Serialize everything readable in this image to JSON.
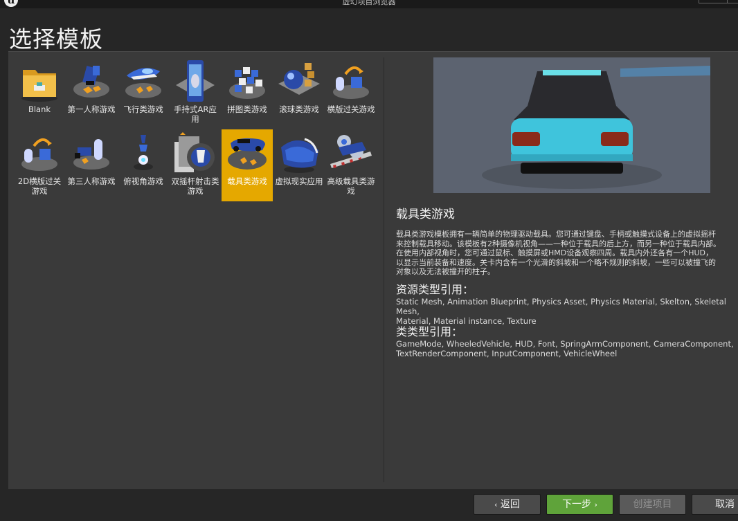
{
  "window": {
    "title": "虚幻项目浏览器",
    "logo": "u"
  },
  "page_title": "选择模板",
  "templates": [
    {
      "label": "Blank",
      "icon": "folder-icon"
    },
    {
      "label": "第一人称游戏",
      "icon": "first-person-icon"
    },
    {
      "label": "飞行类游戏",
      "icon": "flying-icon"
    },
    {
      "label": "手持式AR应用",
      "icon": "handheld-ar-icon"
    },
    {
      "label": "拼图类游戏",
      "icon": "puzzle-icon"
    },
    {
      "label": "滚球类游戏",
      "icon": "rolling-icon"
    },
    {
      "label": "横版过关游戏",
      "icon": "side-scroller-icon"
    },
    {
      "label": "2D横版过关游戏",
      "icon": "2d-side-scroller-icon"
    },
    {
      "label": "第三人称游戏",
      "icon": "third-person-icon"
    },
    {
      "label": "俯视角游戏",
      "icon": "top-down-icon"
    },
    {
      "label": "双摇杆射击类游戏",
      "icon": "twin-stick-icon"
    },
    {
      "label": "载具类游戏",
      "icon": "vehicle-icon",
      "selected": true
    },
    {
      "label": "虚拟现实应用",
      "icon": "vr-icon"
    },
    {
      "label": "高级载具类游戏",
      "icon": "advanced-vehicle-icon"
    }
  ],
  "detail": {
    "title": "载具类游戏",
    "description": "载具类游戏模板拥有一辆简单的物理驱动载具。您可通过键盘、手柄或触摸式设备上的虚拟摇杆\n来控制载具移动。该模板有2种摄像机视角——一种位于载具的后上方，而另一种位于载具内部。\n在使用内部视角时，您可通过鼠标、触摸屏或HMD设备观察四周。载具内外还各有一个HUD，\n以显示当前装备和速度。关卡内含有一个光滑的斜坡和一个略不规则的斜坡，一些可以被撞飞的\n对象以及无法被撞开的柱子。",
    "asset_heading": "资源类型引用：",
    "asset_list": "Static Mesh, Animation Blueprint, Physics Asset, Physics Material, Skelton, Skeletal Mesh,\nMaterial, Material instance, Texture",
    "class_heading": "类类型引用：",
    "class_list": "GameMode, WheeledVehicle, HUD, Font, SpringArmComponent, CameraComponent,\nTextRenderComponent, InputComponent, VehicleWheel"
  },
  "footer": {
    "back": "返回",
    "next": "下一步",
    "create": "创建项目",
    "cancel": "取消"
  },
  "colors": {
    "selected": "#e5a800",
    "next": "#5fa33a",
    "car": "#3fc4dc"
  }
}
